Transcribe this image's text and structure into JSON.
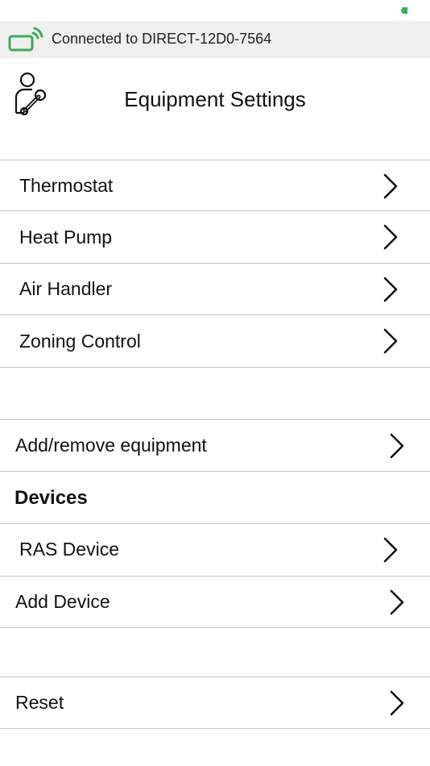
{
  "colors": {
    "accent_green": "#3daa5c",
    "banner_bg": "#efefef",
    "divider": "#c4c4c4"
  },
  "status_bar": {
    "battery_icon": "battery-icon"
  },
  "connection": {
    "icon": "wifi-signal-icon",
    "text": "Connected to DIRECT-12D0-7564"
  },
  "header": {
    "icon": "technician-wrench-icon",
    "title": "Equipment Settings"
  },
  "equipment": {
    "items": [
      {
        "label": "Thermostat"
      },
      {
        "label": "Heat Pump"
      },
      {
        "label": "Air Handler"
      },
      {
        "label": "Zoning Control"
      }
    ]
  },
  "add_remove": {
    "label": "Add/remove equipment"
  },
  "devices": {
    "header": "Devices",
    "items": [
      {
        "label": "RAS Device"
      },
      {
        "label": "Add Device"
      }
    ]
  },
  "reset": {
    "label": "Reset"
  }
}
